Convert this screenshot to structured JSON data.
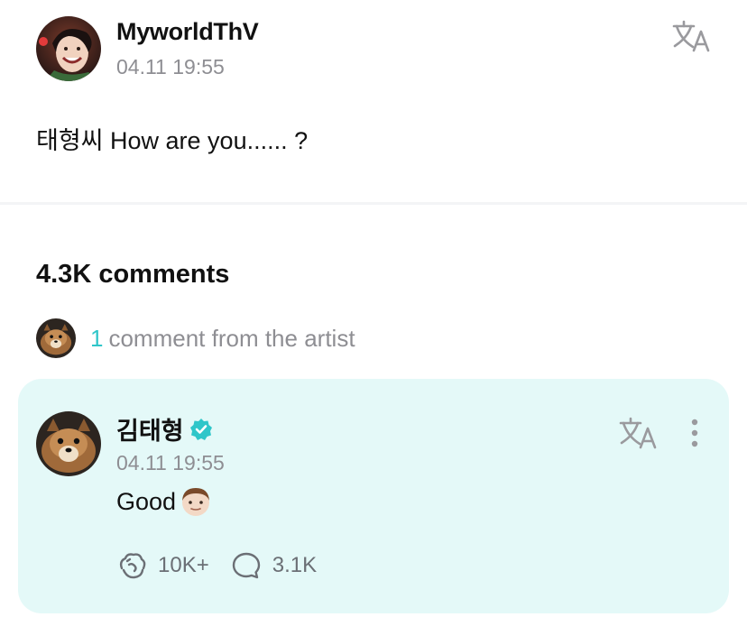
{
  "post": {
    "author": "MyworldThV",
    "timestamp": "04.11 19:55",
    "body": "태형씨 How are you......  ?",
    "avatar_icon": "profile-photo",
    "translate_icon": "translate-icon"
  },
  "comments": {
    "count_label": "4.3K comments",
    "artist_summary": {
      "count": "1",
      "text": "comment from the artist"
    }
  },
  "artist_comment": {
    "author": "김태형",
    "verified_icon": "verified-badge-icon",
    "timestamp": "04.11 19:55",
    "text": "Good",
    "emoji": "boy-face-emoji",
    "likes": "10K+",
    "replies": "3.1K",
    "like_icon": "like-icon",
    "reply_icon": "comment-bubble-icon",
    "more_icon": "more-vertical-icon"
  },
  "colors": {
    "accent": "#2fc6c9",
    "card_background": "#e4f9f8",
    "secondary_text": "#8e8e93",
    "divider": "#f3f4f6"
  }
}
